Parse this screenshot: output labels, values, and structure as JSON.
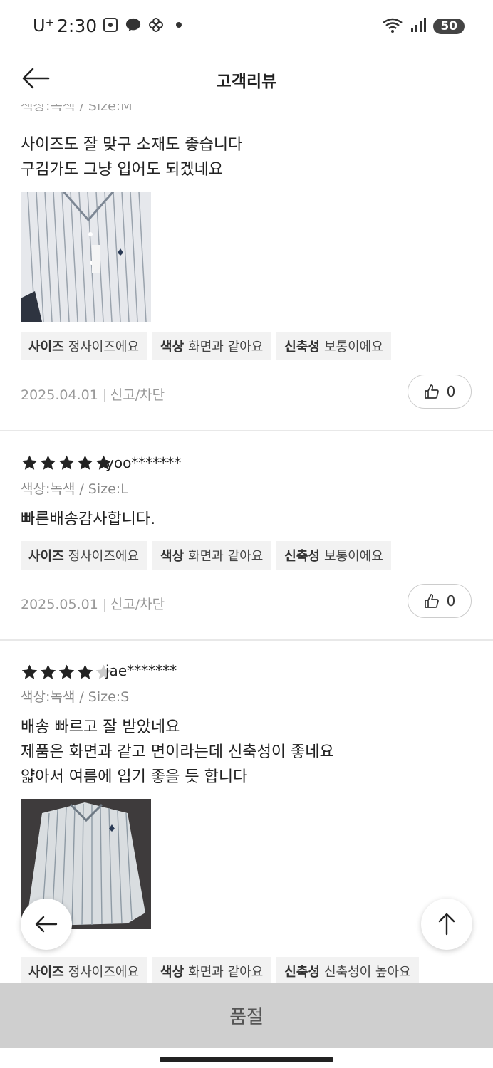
{
  "status_bar": {
    "carrier": "U⁺",
    "time": "2:30",
    "battery": "50"
  },
  "header": {
    "title": "고객리뷰"
  },
  "reviews": [
    {
      "meta_partial": "색상:녹색 / Size:M",
      "text_lines": [
        "사이즈도 잘 맞구 소재도 좋습니다",
        "구김가도 그냥 입어도 되겠네요"
      ],
      "has_photo": true,
      "tags": [
        {
          "label": "사이즈",
          "value": "정사이즈에요"
        },
        {
          "label": "색상",
          "value": "화면과 같아요"
        },
        {
          "label": "신축성",
          "value": "보통이에요"
        }
      ],
      "date": "2025.04.01",
      "report": "신고/차단",
      "likes": "0"
    },
    {
      "rating": 5,
      "user": "yoo*******",
      "meta": "색상:녹색 / Size:L",
      "text_lines": [
        "빠른배송감사합니다."
      ],
      "tags": [
        {
          "label": "사이즈",
          "value": "정사이즈에요"
        },
        {
          "label": "색상",
          "value": "화면과 같아요"
        },
        {
          "label": "신축성",
          "value": "보통이에요"
        }
      ],
      "date": "2025.05.01",
      "report": "신고/차단",
      "likes": "0"
    },
    {
      "rating": 4,
      "user": "jae*******",
      "meta": "색상:녹색 / Size:S",
      "text_lines": [
        "배송 빠르고 잘 받았네요",
        "제품은 화면과 같고 면이라는데 신축성이 좋네요",
        "얇아서 여름에 입기 좋을 듯 합니다"
      ],
      "has_photo": true,
      "tags": [
        {
          "label": "사이즈",
          "value": "정사이즈에요"
        },
        {
          "label": "색상",
          "value": "화면과 같아요"
        },
        {
          "label": "신축성",
          "value": "신축성이 높아요"
        }
      ]
    }
  ],
  "bottom": {
    "soldout_label": "품절"
  },
  "colors": {
    "star_filled": "#222222",
    "star_empty": "#cccccc",
    "tag_bg": "#f2f2f2",
    "bottom_bar": "#cfcfcf"
  },
  "icons": [
    "back-arrow-icon",
    "thumbs-up-icon",
    "scroll-top-icon",
    "star-icon",
    "wifi-icon",
    "signal-icon"
  ]
}
